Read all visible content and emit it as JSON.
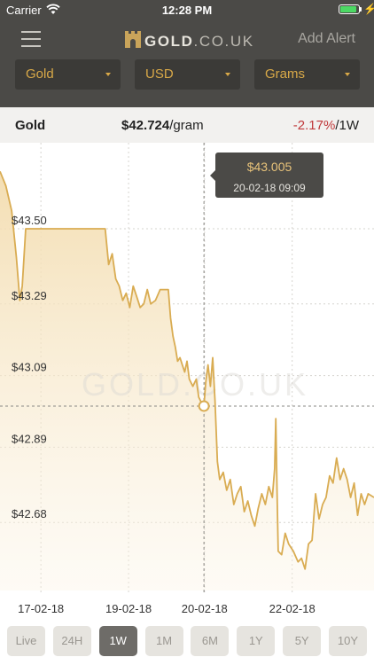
{
  "status_bar": {
    "carrier": "Carrier",
    "time": "12:28 PM",
    "battery_level": 0.92
  },
  "header": {
    "logo_brand": "GOLD",
    "logo_suffix": ".CO.UK",
    "add_alert": "Add Alert"
  },
  "filters": {
    "metal": "Gold",
    "currency": "USD",
    "unit": "Grams"
  },
  "price_row": {
    "metal": "Gold",
    "price": "$42.724",
    "price_unit": "/gram",
    "change": "-2.17%",
    "period": "/1W"
  },
  "tooltip": {
    "price": "$43.005",
    "datetime": "20-02-18 09:09"
  },
  "watermark": "GOLD.CO.UK",
  "chart_data": {
    "type": "area",
    "x_tick_labels": [
      "17-02-18",
      "19-02-18",
      "20-02-18",
      "22-02-18"
    ],
    "y_tick_labels": [
      "$43.50",
      "$43.29",
      "$43.09",
      "$42.89",
      "$42.68"
    ],
    "y_ticks": [
      43.5,
      43.29,
      43.09,
      42.89,
      42.68
    ],
    "x_tick_positions": [
      0.3,
      1.8,
      3.1,
      4.6
    ],
    "xlim": [
      -0.4,
      6.0
    ],
    "ylim": [
      42.49,
      43.74
    ],
    "series_color": "#d9ac52",
    "crosshair": {
      "x": 3.09,
      "y": 43.005
    },
    "points": [
      [
        -0.4,
        43.66
      ],
      [
        -0.3,
        43.62
      ],
      [
        -0.2,
        43.55
      ],
      [
        -0.12,
        43.42
      ],
      [
        -0.06,
        43.3
      ],
      [
        -0.02,
        43.34
      ],
      [
        0.04,
        43.5
      ],
      [
        0.1,
        43.5
      ],
      [
        0.6,
        43.5
      ],
      [
        1.2,
        43.5
      ],
      [
        1.3,
        43.5
      ],
      [
        1.4,
        43.5
      ],
      [
        1.46,
        43.4
      ],
      [
        1.52,
        43.43
      ],
      [
        1.58,
        43.36
      ],
      [
        1.64,
        43.34
      ],
      [
        1.7,
        43.3
      ],
      [
        1.76,
        43.32
      ],
      [
        1.82,
        43.28
      ],
      [
        1.88,
        43.34
      ],
      [
        1.94,
        43.31
      ],
      [
        2.0,
        43.28
      ],
      [
        2.06,
        43.29
      ],
      [
        2.12,
        43.33
      ],
      [
        2.18,
        43.29
      ],
      [
        2.26,
        43.3
      ],
      [
        2.34,
        43.33
      ],
      [
        2.42,
        43.33
      ],
      [
        2.48,
        43.33
      ],
      [
        2.52,
        43.25
      ],
      [
        2.56,
        43.2
      ],
      [
        2.6,
        43.17
      ],
      [
        2.64,
        43.13
      ],
      [
        2.68,
        43.14
      ],
      [
        2.72,
        43.12
      ],
      [
        2.76,
        43.1
      ],
      [
        2.8,
        43.13
      ],
      [
        2.84,
        43.08
      ],
      [
        2.9,
        43.06
      ],
      [
        2.96,
        43.08
      ],
      [
        3.0,
        43.03
      ],
      [
        3.06,
        43.01
      ],
      [
        3.09,
        43.005
      ],
      [
        3.12,
        43.07
      ],
      [
        3.16,
        43.12
      ],
      [
        3.2,
        43.06
      ],
      [
        3.24,
        43.14
      ],
      [
        3.28,
        43.02
      ],
      [
        3.32,
        42.85
      ],
      [
        3.36,
        42.8
      ],
      [
        3.42,
        42.82
      ],
      [
        3.48,
        42.77
      ],
      [
        3.54,
        42.8
      ],
      [
        3.6,
        42.73
      ],
      [
        3.66,
        42.76
      ],
      [
        3.72,
        42.78
      ],
      [
        3.78,
        42.71
      ],
      [
        3.84,
        42.74
      ],
      [
        3.9,
        42.7
      ],
      [
        3.96,
        42.67
      ],
      [
        4.02,
        42.72
      ],
      [
        4.08,
        42.76
      ],
      [
        4.14,
        42.73
      ],
      [
        4.2,
        42.78
      ],
      [
        4.26,
        42.75
      ],
      [
        4.3,
        42.83
      ],
      [
        4.32,
        42.97
      ],
      [
        4.34,
        42.78
      ],
      [
        4.36,
        42.6
      ],
      [
        4.42,
        42.59
      ],
      [
        4.48,
        42.65
      ],
      [
        4.54,
        42.62
      ],
      [
        4.62,
        42.6
      ],
      [
        4.7,
        42.57
      ],
      [
        4.76,
        42.58
      ],
      [
        4.82,
        42.55
      ],
      [
        4.88,
        42.62
      ],
      [
        4.94,
        42.63
      ],
      [
        5.0,
        42.76
      ],
      [
        5.06,
        42.69
      ],
      [
        5.12,
        42.73
      ],
      [
        5.18,
        42.75
      ],
      [
        5.24,
        42.81
      ],
      [
        5.3,
        42.79
      ],
      [
        5.36,
        42.86
      ],
      [
        5.42,
        42.8
      ],
      [
        5.48,
        42.83
      ],
      [
        5.54,
        42.8
      ],
      [
        5.6,
        42.75
      ],
      [
        5.66,
        42.79
      ],
      [
        5.72,
        42.7
      ],
      [
        5.78,
        42.76
      ],
      [
        5.84,
        42.73
      ],
      [
        5.9,
        42.76
      ],
      [
        6.0,
        42.75
      ]
    ]
  },
  "ranges": [
    {
      "label": "Live",
      "active": false
    },
    {
      "label": "24H",
      "active": false
    },
    {
      "label": "1W",
      "active": true
    },
    {
      "label": "1M",
      "active": false
    },
    {
      "label": "6M",
      "active": false
    },
    {
      "label": "1Y",
      "active": false
    },
    {
      "label": "5Y",
      "active": false
    },
    {
      "label": "10Y",
      "active": false
    }
  ]
}
